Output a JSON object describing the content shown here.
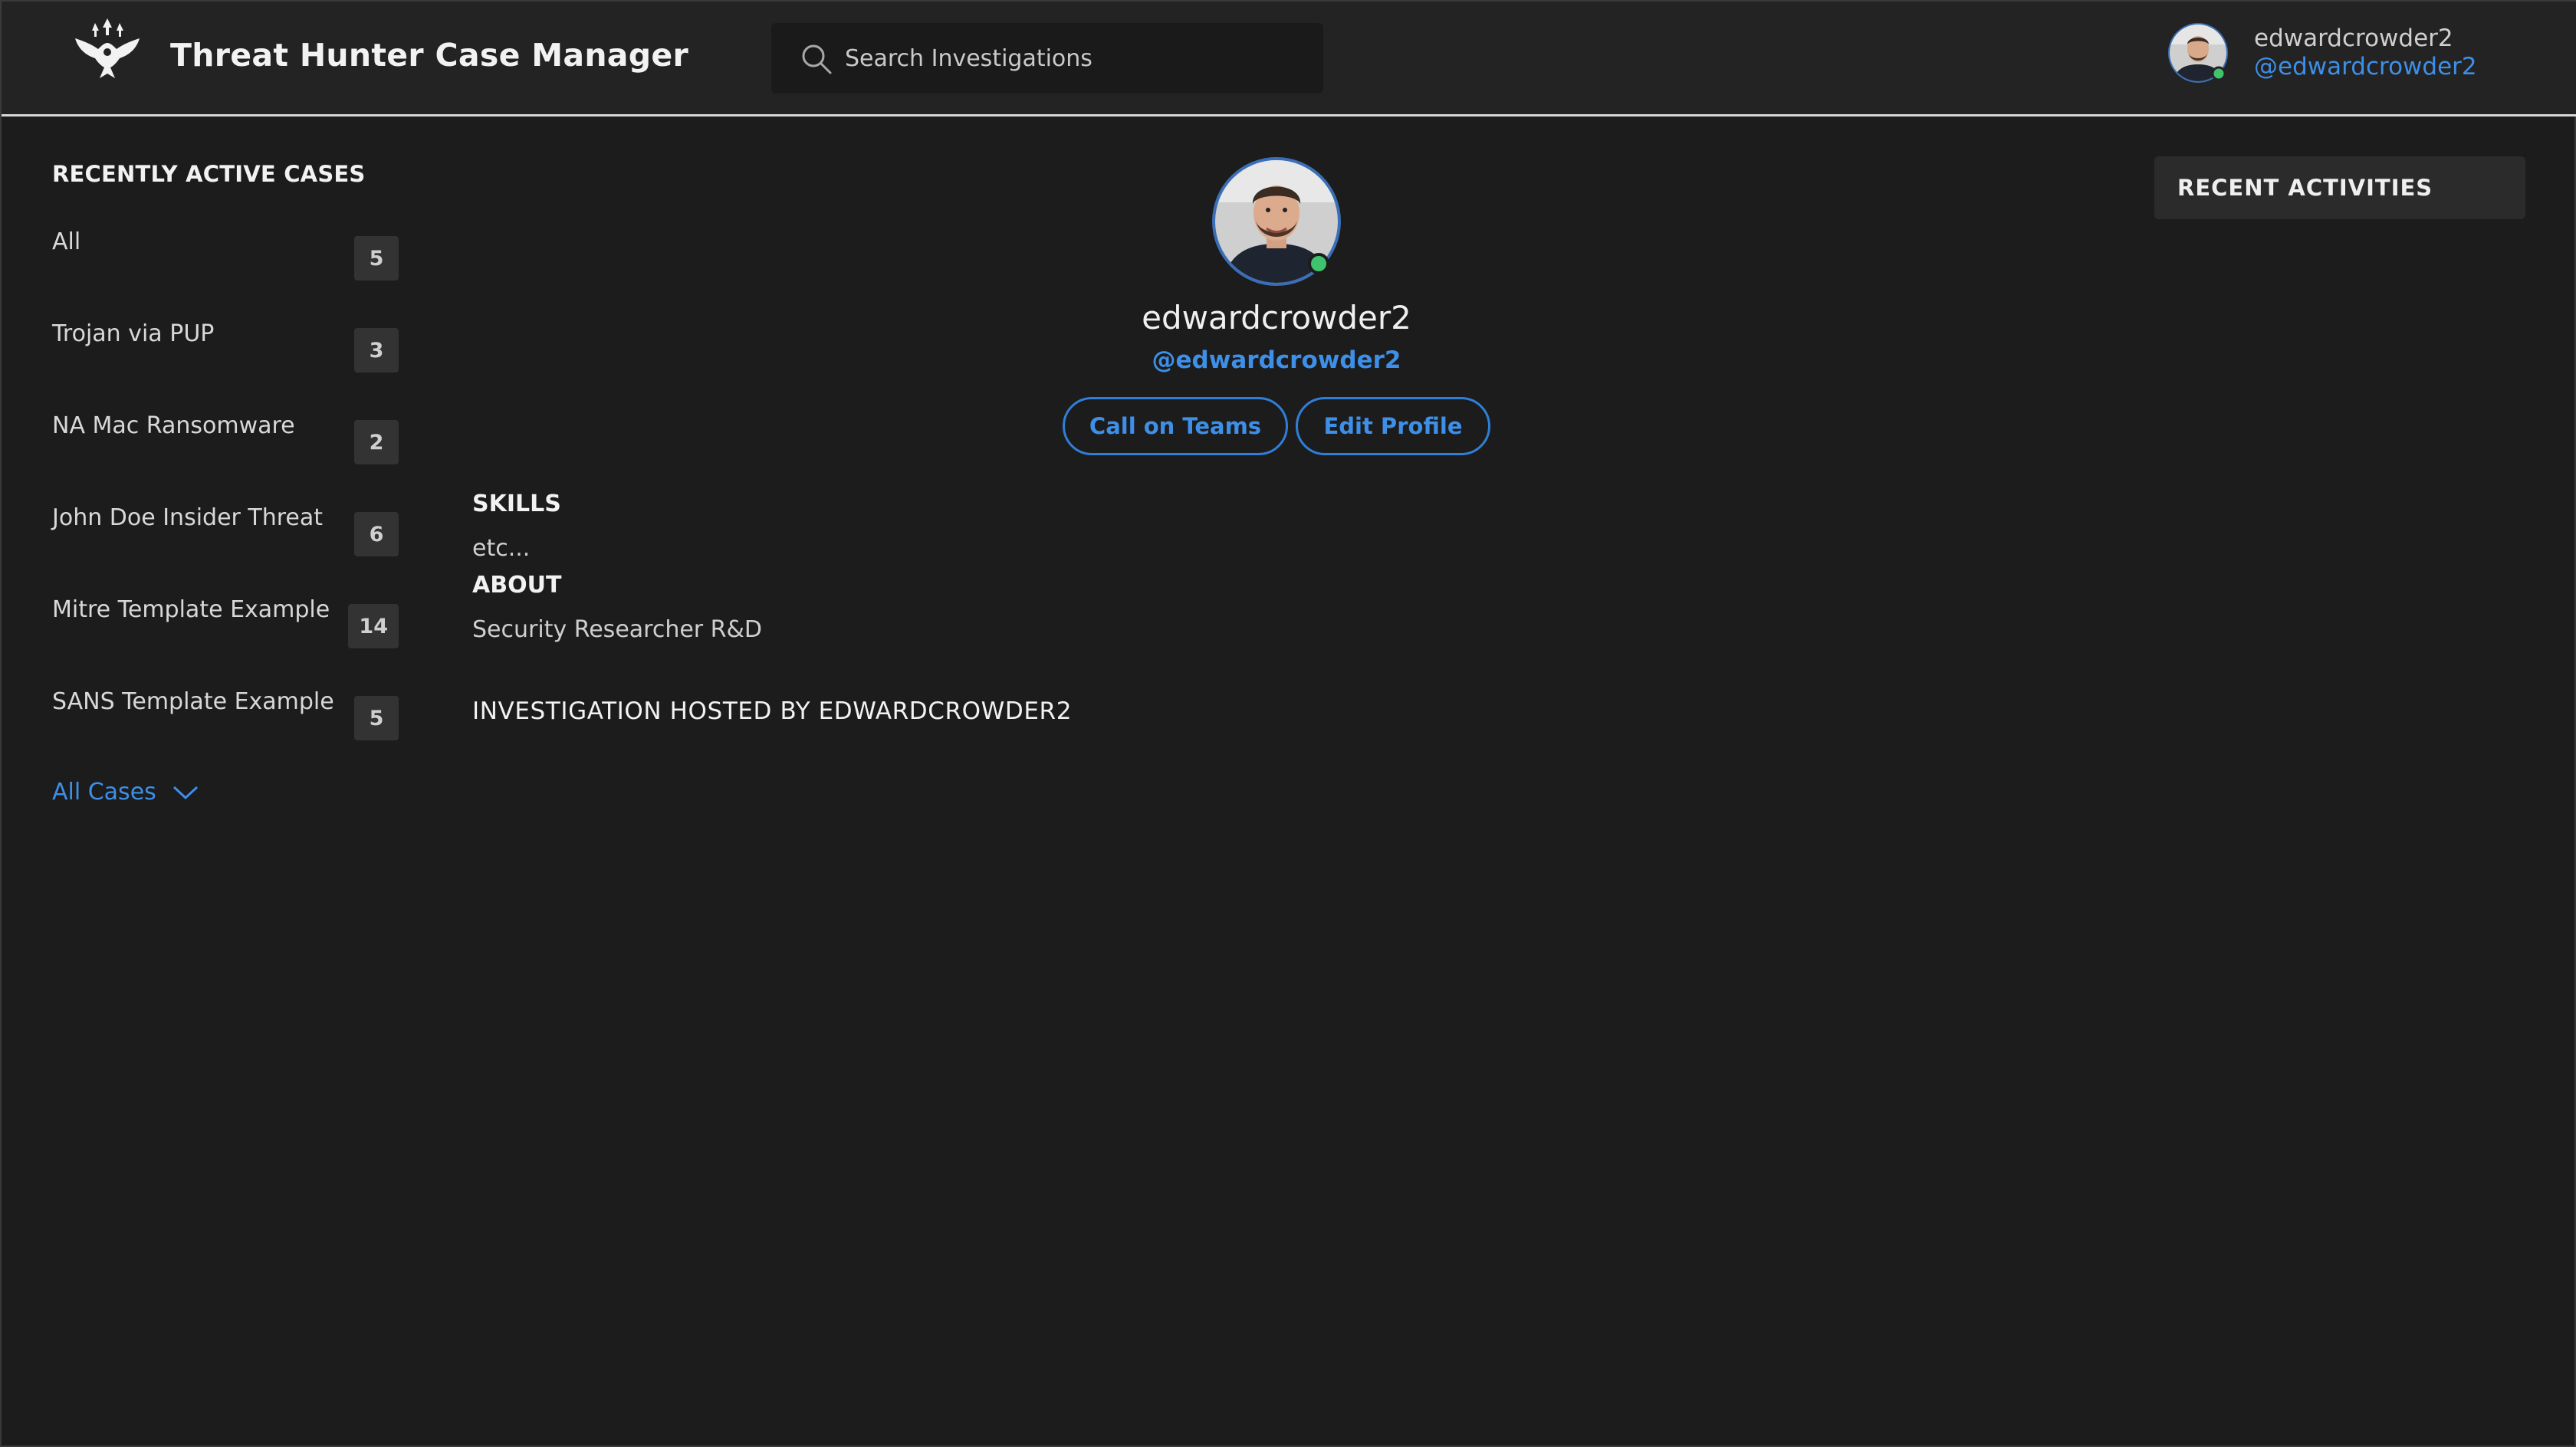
{
  "header": {
    "app_title": "Threat Hunter Case Manager",
    "search_placeholder": "Search Investigations",
    "user": {
      "name": "edwardcrowder2",
      "handle": "@edwardcrowder2",
      "status": "online"
    }
  },
  "sidebar": {
    "title": "RECENTLY ACTIVE CASES",
    "cases": [
      {
        "label": "All",
        "count": "5"
      },
      {
        "label": "Trojan via PUP",
        "count": "3"
      },
      {
        "label": "NA Mac Ransomware",
        "count": "2"
      },
      {
        "label": "John Doe Insider Threat",
        "count": "6"
      },
      {
        "label": "Mitre Template Example",
        "count": "14"
      },
      {
        "label": "SANS Template Example",
        "count": "5"
      }
    ],
    "all_cases_label": "All Cases"
  },
  "profile": {
    "name": "edwardcrowder2",
    "handle": "@edwardcrowder2",
    "call_button": "Call on Teams",
    "edit_button": "Edit Profile",
    "skills_heading": "SKILLS",
    "skills_text": "etc...",
    "about_heading": "ABOUT",
    "about_text": "Security Researcher R&D",
    "investigation_heading": "INVESTIGATION HOSTED BY EDWARDCROWDER2"
  },
  "recent_activities": {
    "title": "RECENT ACTIVITIES"
  },
  "colors": {
    "accent": "#3d8fe8",
    "background": "#1c1c1c",
    "header": "#232323",
    "online": "#3ec46d"
  }
}
